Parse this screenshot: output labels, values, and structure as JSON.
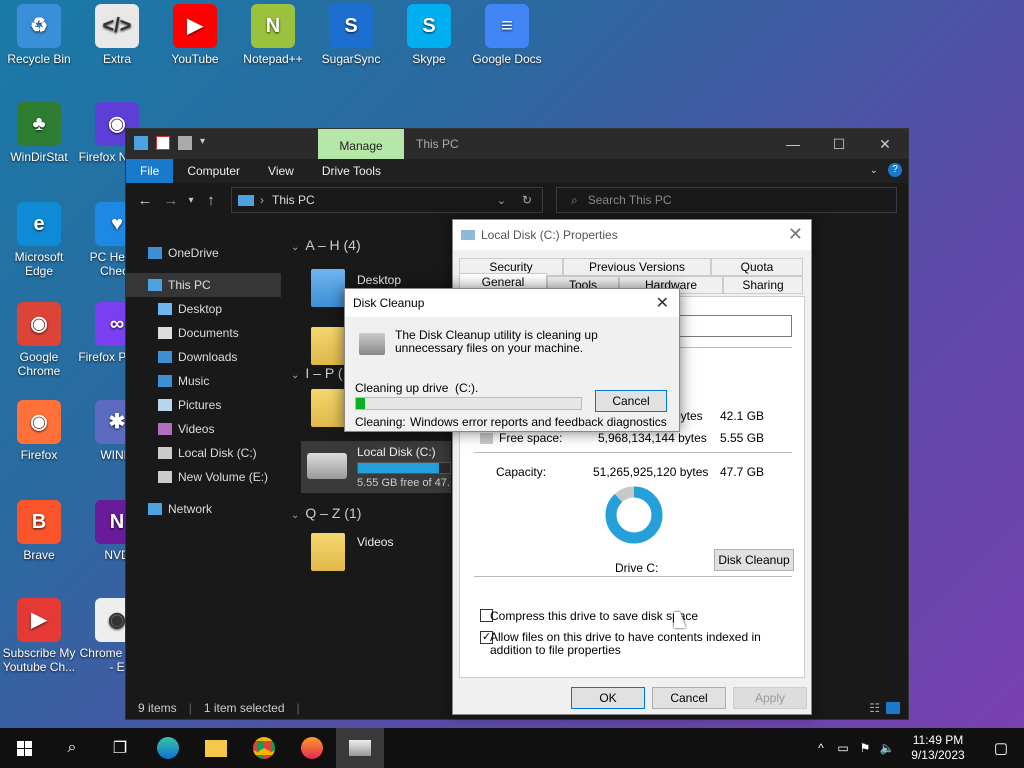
{
  "desktop": {
    "icons": [
      {
        "label": "Recycle Bin",
        "color": "#3a8fd8",
        "glyph": "♻"
      },
      {
        "label": "Extra",
        "color": "#e8e8e8",
        "glyph": "</>"
      },
      {
        "label": "YouTube",
        "color": "#ff0000",
        "glyph": "▶"
      },
      {
        "label": "Notepad++",
        "color": "#9bc23c",
        "glyph": "N"
      },
      {
        "label": "SugarSync",
        "color": "#1c6fd0",
        "glyph": "S"
      },
      {
        "label": "Skype",
        "color": "#00aff0",
        "glyph": "S"
      },
      {
        "label": "Google Docs",
        "color": "#4285f4",
        "glyph": "≡"
      },
      {
        "label": "WinDirStat",
        "color": "#2e7d32",
        "glyph": "♣"
      },
      {
        "label": "Firefox Nightly",
        "color": "#5b3fd6",
        "glyph": "◉"
      },
      {
        "label": "Microsoft Edge",
        "color": "#0f8ad4",
        "glyph": "e"
      },
      {
        "label": "PC Health Check",
        "color": "#1e88e5",
        "glyph": "♥"
      },
      {
        "label": "Google Chrome",
        "color": "#db4437",
        "glyph": "◉"
      },
      {
        "label": "Firefox Private",
        "color": "#7b3ff2",
        "glyph": "∞"
      },
      {
        "label": "Firefox",
        "color": "#ff7139",
        "glyph": "◉"
      },
      {
        "label": "WINM",
        "color": "#5c6bc0",
        "glyph": "✱"
      },
      {
        "label": "Brave",
        "color": "#fb542b",
        "glyph": "B"
      },
      {
        "label": "NVD",
        "color": "#6a1b9a",
        "glyph": "N"
      },
      {
        "label": "Subscribe My Youtube Ch...",
        "color": "#e53935",
        "glyph": "▶"
      },
      {
        "label": "Chrome Store - E",
        "color": "#eeeeee",
        "glyph": "◉"
      }
    ]
  },
  "explorer": {
    "title": "This PC",
    "manage_tab": "Manage",
    "ribbon": {
      "file": "File",
      "computer": "Computer",
      "view": "View",
      "drive_tools": "Drive Tools"
    },
    "address": "This PC",
    "search_placeholder": "Search This PC",
    "sidebar": [
      "OneDrive",
      "This PC",
      "Desktop",
      "Documents",
      "Downloads",
      "Music",
      "Pictures",
      "Videos",
      "Local Disk (C:)",
      "New Volume (E:)",
      "Network"
    ],
    "groups": {
      "ah": "A – H (4)",
      "ip": "I – P (",
      "qz": "Q – Z (1)"
    },
    "items": {
      "desktop": "Desktop",
      "local_disk": "Local Disk (C:)",
      "local_disk_free": "5.55 GB free of 47.",
      "local_disk_used_fraction": 0.88,
      "videos": "Videos"
    },
    "status": {
      "count": "9 items",
      "selected": "1 item selected"
    }
  },
  "properties": {
    "title": "Local Disk (C:) Properties",
    "tabs_top": [
      "Security",
      "Previous Versions",
      "Quota"
    ],
    "tabs_bottom": [
      "General",
      "Tools",
      "Hardware",
      "Sharing"
    ],
    "used_bytes": "bytes",
    "used_gb": "42.1 GB",
    "free_label": "Free space:",
    "free_bytes": "5,968,134,144 bytes",
    "free_gb": "5.55 GB",
    "capacity_label": "Capacity:",
    "capacity_bytes": "51,265,925,120 bytes",
    "capacity_gb": "47.7 GB",
    "drive_label": "Drive C:",
    "disk_cleanup_btn": "Disk Cleanup",
    "compress_label": "Compress this drive to save disk space",
    "index_label": "Allow files on this drive to have contents indexed in addition to file properties",
    "ok": "OK",
    "cancel": "Cancel",
    "apply": "Apply",
    "used_fraction": 0.88
  },
  "cleanup": {
    "title": "Disk Cleanup",
    "message": "The Disk Cleanup utility is cleaning up unnecessary files on your machine.",
    "progress_label": "Cleaning up drive  (C:).",
    "cancel": "Cancel",
    "cleaning_label": "Cleaning:",
    "cleaning_item": "Windows error reports and feedback diagnostics",
    "progress_fraction": 0.04
  },
  "taskbar": {
    "time": "11:49 PM",
    "date": "9/13/2023"
  },
  "colors": {
    "accent": "#1979ca",
    "progress": "#06b025",
    "donut_used": "#26a0da",
    "donut_free": "#c8c8c8"
  }
}
